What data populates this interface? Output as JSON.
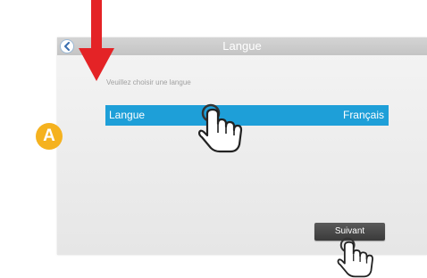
{
  "header": {
    "title": "Langue",
    "back_icon": "chevron-left-icon"
  },
  "prompt": "Veuillez choisir une langue",
  "language_row": {
    "label": "Langue",
    "value": "Français"
  },
  "next_button": {
    "label": "Suivant"
  },
  "annotations": {
    "step_badge": "A",
    "arrow_icon": "red-down-arrow-icon",
    "pointer_icon": "hand-pointer-icon"
  },
  "colors": {
    "row_highlight": "#1e9fd8",
    "titlebar": "#c8c8c8",
    "badge": "#f5b21f",
    "arrow": "#e42326",
    "button": "#444444"
  }
}
